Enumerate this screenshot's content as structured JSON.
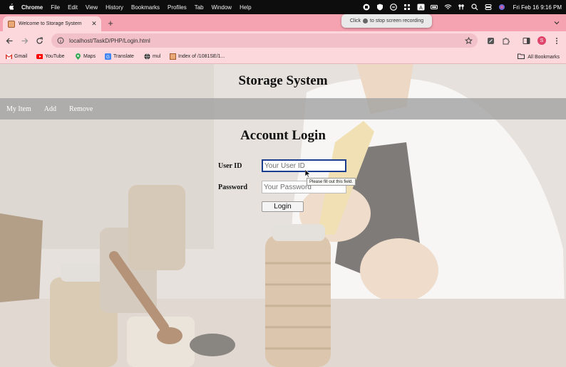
{
  "menubar": {
    "items": [
      "Chrome",
      "File",
      "Edit",
      "View",
      "History",
      "Bookmarks",
      "Profiles",
      "Tab",
      "Window",
      "Help"
    ],
    "clock": "Fri Feb 16  9:16 PM"
  },
  "recording_tip": {
    "text_before": "Click",
    "text_after": "to stop screen recording"
  },
  "browser": {
    "tab_title": "Welcome to Storage System",
    "url": "localhost/TaskD/PHP/Login.html",
    "profile_initial": "S"
  },
  "bookmarks": {
    "items": [
      "Gmail",
      "YouTube",
      "Maps",
      "Translate",
      "mul",
      "Index of /1081SE/1..."
    ],
    "all_label": "All Bookmarks"
  },
  "page": {
    "site_title": "Storage System",
    "nav": [
      "My Item",
      "Add",
      "Remove"
    ],
    "login_title": "Account Login",
    "user_id_label": "User ID",
    "user_id_placeholder": "Your User ID",
    "password_label": "Password",
    "password_placeholder": "Your Password",
    "login_button": "Login",
    "validation_message": "Please fill out this field."
  },
  "colors": {
    "tabbar": "#f6a3b1",
    "toolbar": "#fcd8dd",
    "nav_bar": "#a0a0a0",
    "focus_ring": "#1a3d8f"
  }
}
